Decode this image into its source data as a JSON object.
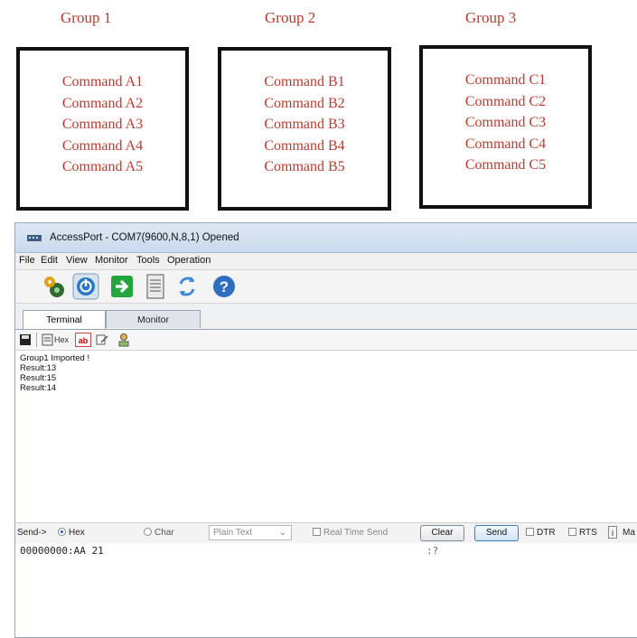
{
  "groups": [
    {
      "title": "Group 1",
      "commands": [
        "Command  A1",
        "Command  A2",
        "Command  A3",
        "Command  A4",
        "Command  A5"
      ]
    },
    {
      "title": "Group 2",
      "commands": [
        "Command  B1",
        "Command  B2",
        "Command  B3",
        "Command  B4",
        "Command  B5"
      ]
    },
    {
      "title": "Group 3",
      "commands": [
        "Command  C1",
        "Command  C2",
        "Command  C3",
        "Command  C4",
        "Command  C5"
      ]
    }
  ],
  "window": {
    "title": "AccessPort - COM7(9600,N,8,1) Opened",
    "menu": [
      "File",
      "Edit",
      "View",
      "Monitor",
      "Tools",
      "Operation"
    ],
    "toolbar_icons": [
      "settings-gear-icon",
      "power-icon",
      "enter-arrow-icon",
      "document-icon",
      "refresh-icon",
      "help-icon"
    ],
    "tabs": [
      "Terminal",
      "Monitor"
    ],
    "subtool": {
      "hex_label": "Hex",
      "ab_label": "ab"
    },
    "output_lines": [
      "Group1 Imported !",
      "Result:13",
      "Result:15",
      "Result:14"
    ],
    "sendbar": {
      "send_label": "Send->",
      "hex_label": "Hex",
      "char_label": "Char",
      "format_value": "Plain Text",
      "realtime_label": "Real Time Send",
      "clear_label": "Clear",
      "send_button_label": "Send",
      "dtr_label": "DTR",
      "rts_label": "RTS",
      "info_glyph": "i",
      "extra_label": "Ma"
    },
    "input": {
      "hex_line": "00000000:AA 21",
      "tail": ":?"
    }
  }
}
